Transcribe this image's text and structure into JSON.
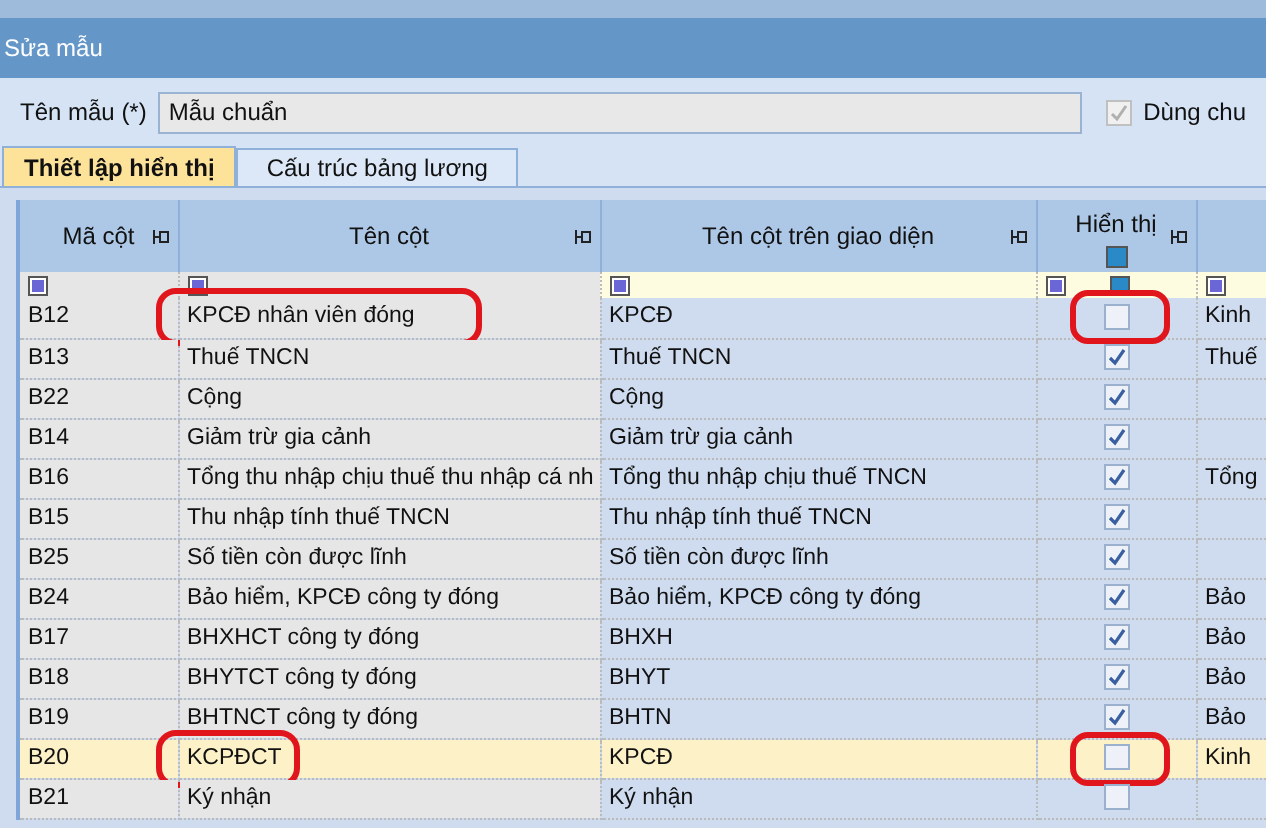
{
  "window": {
    "title": "Sửa mẫu"
  },
  "template_name": {
    "label": "Tên mẫu (*)",
    "value": "Mẫu chuẩn"
  },
  "use_shared": {
    "label": "Dùng chu",
    "checked": true,
    "disabled": true
  },
  "tabs": [
    {
      "label": "Thiết lập hiển thị",
      "selected": true
    },
    {
      "label": "Cấu trúc bảng lương",
      "selected": false
    }
  ],
  "table": {
    "columns": [
      "Mã cột",
      "Tên cột",
      "Tên cột trên giao diện",
      "Hiển thị"
    ],
    "rows": [
      {
        "code": "B12",
        "name": "KPCĐ nhân viên đóng",
        "display_name": "KPCĐ",
        "shown": false,
        "column_5": "Kinh",
        "selected": false,
        "name_circled": true,
        "check_circled": true
      },
      {
        "code": "B13",
        "name": "Thuế TNCN",
        "display_name": "Thuế TNCN",
        "shown": true,
        "column_5": "Thuế",
        "selected": false,
        "name_circled": false,
        "check_circled": false
      },
      {
        "code": "B22",
        "name": "Cộng",
        "display_name": "Cộng",
        "shown": true,
        "selected": false,
        "name_circled": false,
        "check_circled": false
      },
      {
        "code": "B14",
        "name": "Giảm trừ gia cảnh",
        "display_name": "Giảm trừ gia cảnh",
        "shown": true,
        "selected": false,
        "name_circled": false,
        "check_circled": false
      },
      {
        "code": "B16",
        "name": "Tổng thu nhập chịu thuế thu nhập cá nh",
        "display_name": "Tổng thu nhập chịu thuế TNCN",
        "shown": true,
        "column_5": "Tổng",
        "selected": false,
        "name_circled": false,
        "check_circled": false
      },
      {
        "code": "B15",
        "name": "Thu nhập tính thuế TNCN",
        "display_name": "Thu nhập tính thuế TNCN",
        "shown": true,
        "selected": false,
        "name_circled": false,
        "check_circled": false
      },
      {
        "code": "B25",
        "name": "Số tiền còn được lĩnh",
        "display_name": "Số tiền còn được lĩnh",
        "shown": true,
        "selected": false,
        "name_circled": false,
        "check_circled": false
      },
      {
        "code": "B24",
        "name": "Bảo hiểm, KPCĐ công ty đóng",
        "display_name": "Bảo hiểm, KPCĐ công ty đóng",
        "shown": true,
        "column_5": "Bảo",
        "selected": false,
        "name_circled": false,
        "check_circled": false
      },
      {
        "code": "B17",
        "name": "BHXHCT công ty đóng",
        "display_name": "BHXH",
        "shown": true,
        "column_5": "Bảo",
        "selected": false,
        "name_circled": false,
        "check_circled": false
      },
      {
        "code": "B18",
        "name": "BHYTCT công ty đóng",
        "display_name": "BHYT",
        "shown": true,
        "column_5": "Bảo",
        "selected": false,
        "name_circled": false,
        "check_circled": false
      },
      {
        "code": "B19",
        "name": "BHTNCT công ty đóng",
        "display_name": "BHTN",
        "shown": true,
        "column_5": "Bảo",
        "selected": false,
        "name_circled": false,
        "check_circled": false
      },
      {
        "code": "B20",
        "name": "KCPĐCT",
        "display_name": "KPCĐ",
        "shown": false,
        "column_5": "Kinh",
        "selected": true,
        "name_circled": true,
        "check_circled": true
      },
      {
        "code": "B21",
        "name": "Ký nhận",
        "display_name": "Ký nhận",
        "shown": false,
        "selected": false,
        "name_circled": false,
        "check_circled": false
      }
    ]
  }
}
